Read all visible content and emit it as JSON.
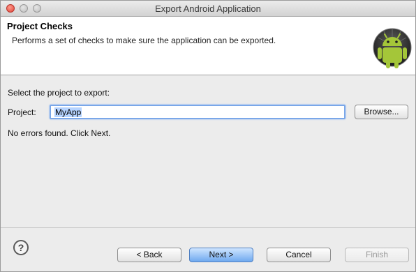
{
  "window": {
    "title": "Export Android Application"
  },
  "header": {
    "title": "Project Checks",
    "description": "Performs a set of checks to make sure the application can be exported.",
    "logo_icon": "android-logo-icon"
  },
  "content": {
    "select_label": "Select the project to export:",
    "project_label": "Project:",
    "project_value": "MyApp",
    "browse_label": "Browse...",
    "status": "No errors found. Click Next."
  },
  "footer": {
    "help_icon": "help-icon",
    "help_glyph": "?",
    "back_label": "< Back",
    "next_label": "Next >",
    "cancel_label": "Cancel",
    "finish_label": "Finish"
  },
  "colors": {
    "accent": "#7aa7e9",
    "android_green": "#a4c639"
  }
}
